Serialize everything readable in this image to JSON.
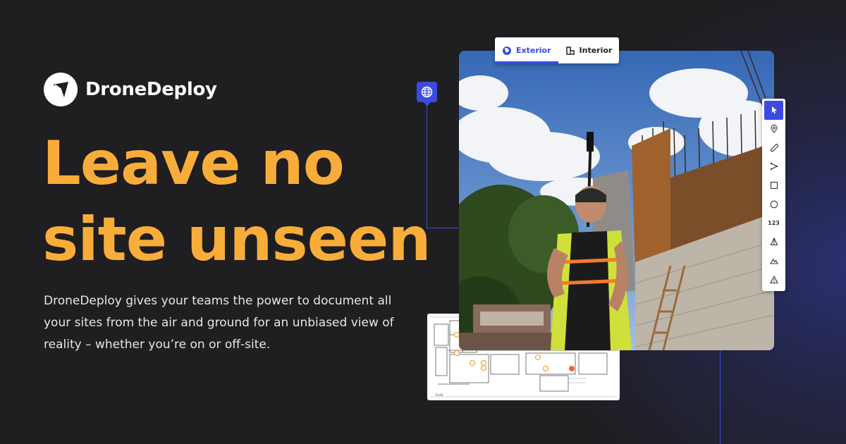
{
  "brand": {
    "name": "DroneDeploy"
  },
  "headline": {
    "line1": "Leave no",
    "line2": "site unseen"
  },
  "description": "DroneDeploy gives your teams the power to document all your sites from the air and ground for an unbiased view of reality – whether you’re on or off-site.",
  "tabs": [
    {
      "label": "Exterior",
      "icon": "globe-icon",
      "active": true
    },
    {
      "label": "Interior",
      "icon": "floor-plan-icon",
      "active": false
    }
  ],
  "toolbar": {
    "tools": [
      {
        "icon": "cursor-icon",
        "active": true
      },
      {
        "icon": "location-pin-icon"
      },
      {
        "icon": "ruler-icon"
      },
      {
        "icon": "polyline-icon"
      },
      {
        "icon": "square-icon"
      },
      {
        "icon": "circle-icon"
      },
      {
        "icon": "count-icon",
        "label": "123"
      },
      {
        "icon": "volume-icon"
      },
      {
        "icon": "elevation-icon"
      },
      {
        "icon": "warning-icon"
      }
    ]
  },
  "colors": {
    "background": "#1f1e20",
    "headline": "#f8ad3b",
    "accent": "#3b4be0"
  }
}
